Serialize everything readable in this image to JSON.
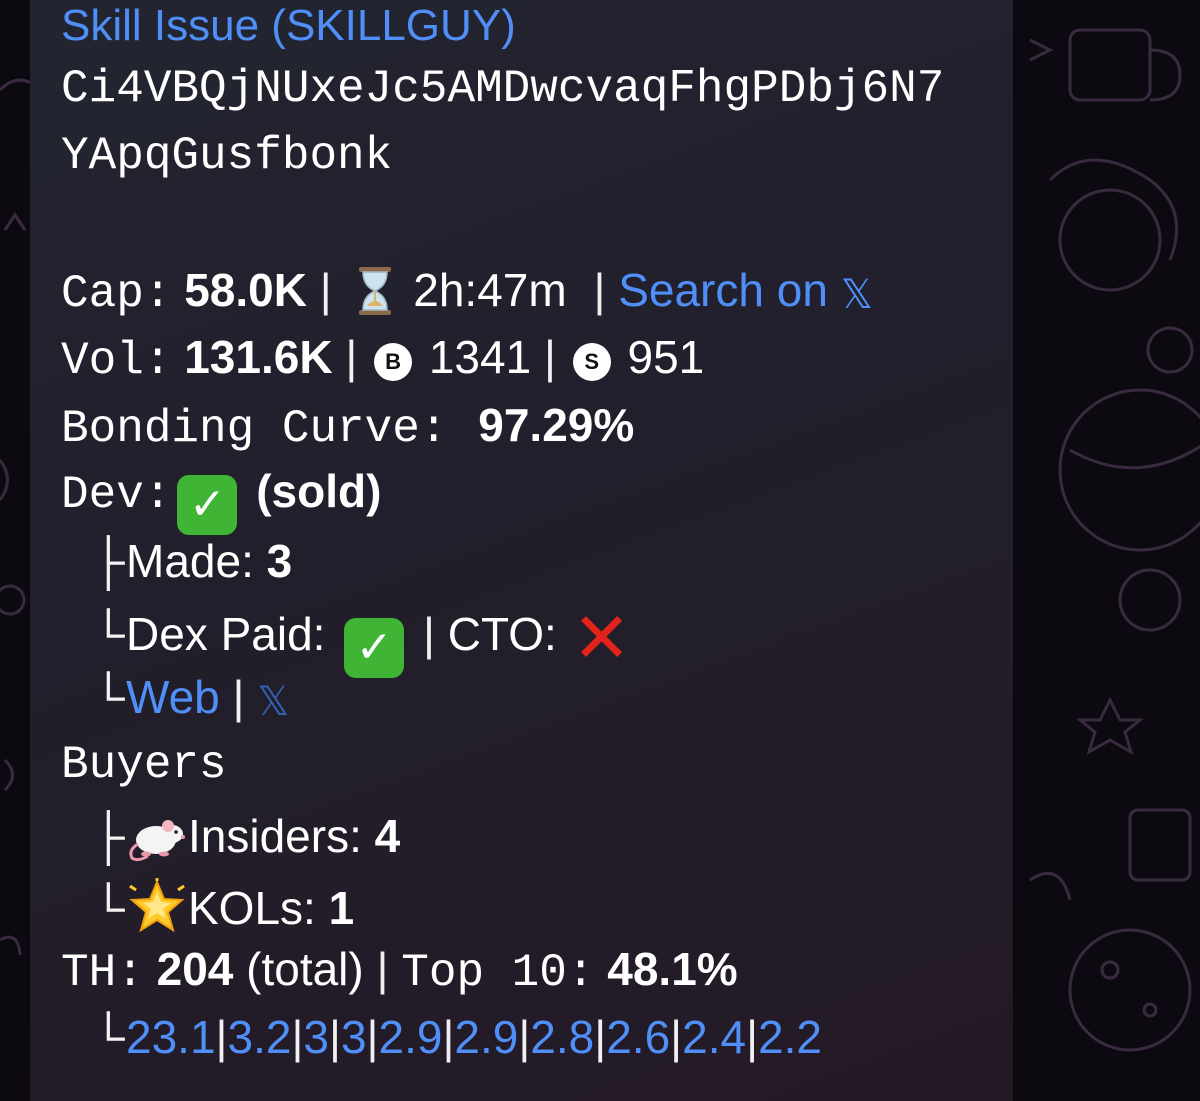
{
  "token": {
    "name": "Skill Issue (SKILLGUY)",
    "address_line1": "Ci4VBQjNUxeJc5AMDwcvaqFhgPDbj6N7",
    "address_line2": "YApqGusfbonk"
  },
  "stats": {
    "cap_label": "Cap:",
    "cap_value": "58.0K",
    "sep": "|",
    "age": "2h:47m",
    "search_label": "Search on",
    "x_glyph": "𝕏",
    "vol_label": "Vol:",
    "vol_value": "131.6K",
    "buys_badge": "B",
    "buys": "1341",
    "sells_badge": "S",
    "sells": "951",
    "bonding_label": "Bonding Curve:",
    "bonding_value": "97.29%"
  },
  "dev": {
    "label": "Dev:",
    "status": "(sold)",
    "made_label": "Made:",
    "made_value": "3",
    "dex_paid_label": "Dex Paid:",
    "cto_label": "CTO:",
    "web_link": "Web"
  },
  "buyers": {
    "label": "Buyers",
    "insiders_label": "Insiders:",
    "insiders_value": "4",
    "kols_label": "KOLs:",
    "kols_value": "1"
  },
  "holders": {
    "th_label": "TH:",
    "total": "204",
    "total_suffix": "(total)",
    "top10_label": "Top 10:",
    "top10_value": "48.1%",
    "top": [
      "23.1",
      "3.2",
      "3",
      "3",
      "2.9",
      "2.9",
      "2.8",
      "2.6",
      "2.4",
      "2.2"
    ]
  },
  "tree": {
    "branch": "├",
    "last": "└"
  },
  "colors": {
    "link": "#4f8ff7",
    "bubble": "#222531",
    "check": "#3fb435",
    "cross": "#e2231a"
  },
  "icons": [
    "hourglass-icon",
    "check-icon",
    "cross-icon",
    "rat-icon",
    "glowing-star-icon",
    "x-logo-icon"
  ]
}
